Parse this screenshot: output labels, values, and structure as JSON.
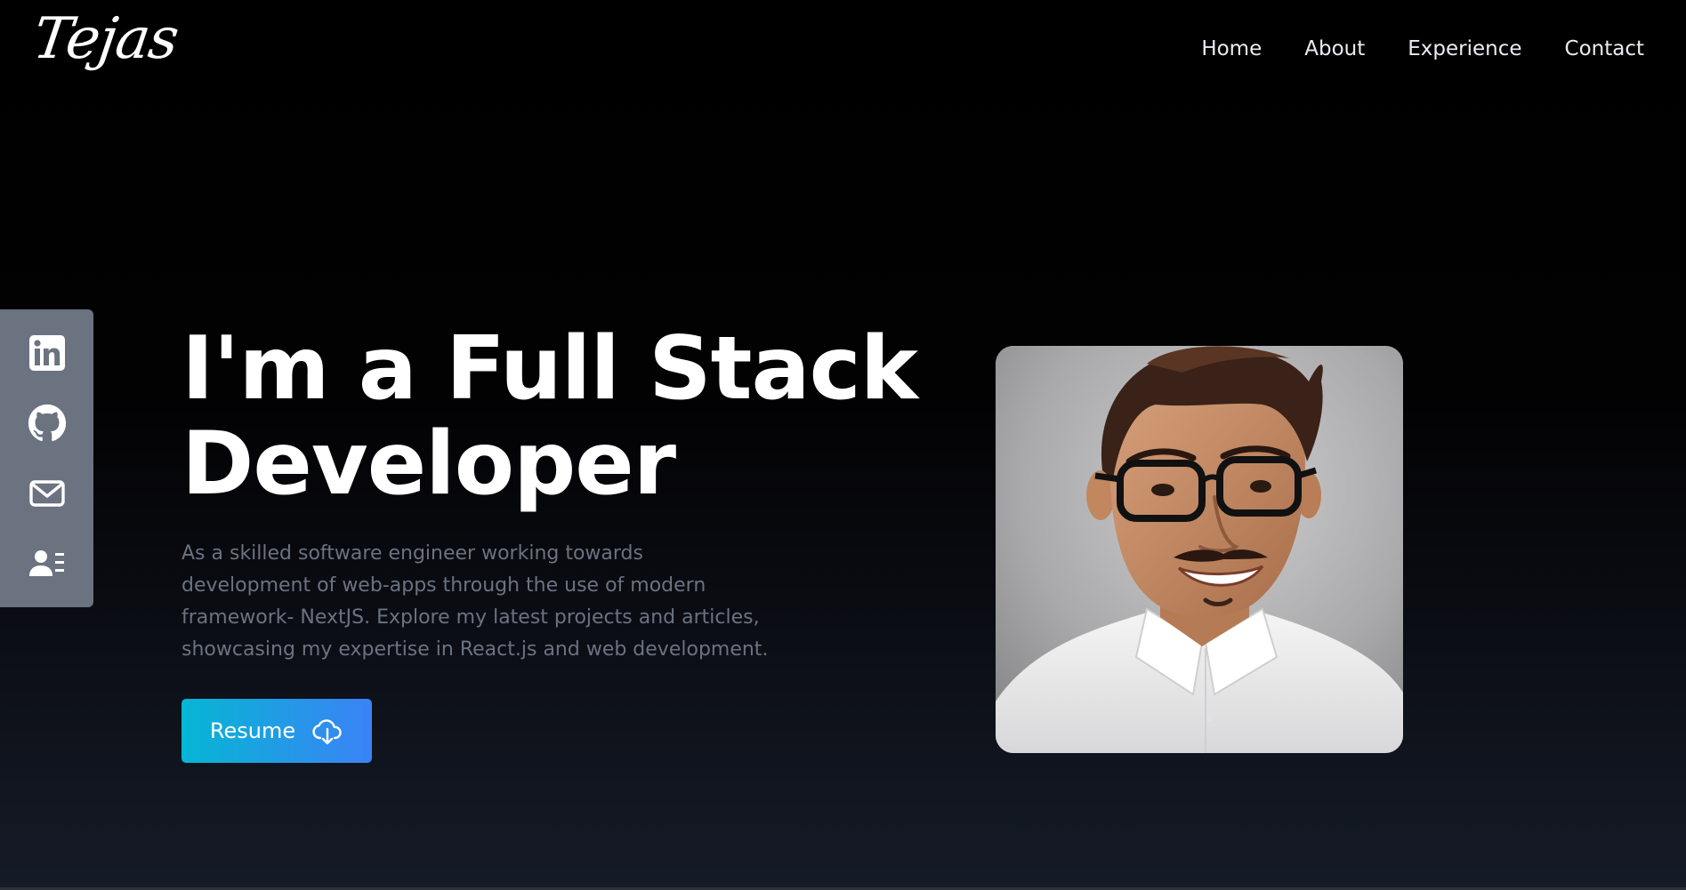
{
  "brand": {
    "logo_text": "Tejas"
  },
  "nav": {
    "items": [
      {
        "label": "Home"
      },
      {
        "label": "About"
      },
      {
        "label": "Experience"
      },
      {
        "label": "Contact"
      }
    ]
  },
  "social": {
    "background": "#6b7280",
    "icons": [
      "linkedin-icon",
      "github-icon",
      "mail-icon",
      "contact-card-icon"
    ]
  },
  "hero": {
    "headline_lines": [
      "I'm a Full Stack",
      "Developer"
    ],
    "description_lines": [
      "As a skilled software engineer working towards",
      "development of web-apps through the use of modern",
      "framework- NextJS. Explore my latest projects and articles,",
      "showcasing my expertise in React.js and web development."
    ],
    "resume_button": {
      "label": "Resume",
      "icon": "cloud-download-icon",
      "gradient": [
        "#06b6d4",
        "#3b82f6"
      ]
    }
  },
  "profile_photo": {
    "subject": "portrait of a smiling young man with glasses and white shirt"
  },
  "colors": {
    "background_top": "#000000",
    "background_bottom": "#151b27",
    "description_text": "#6b7280"
  }
}
